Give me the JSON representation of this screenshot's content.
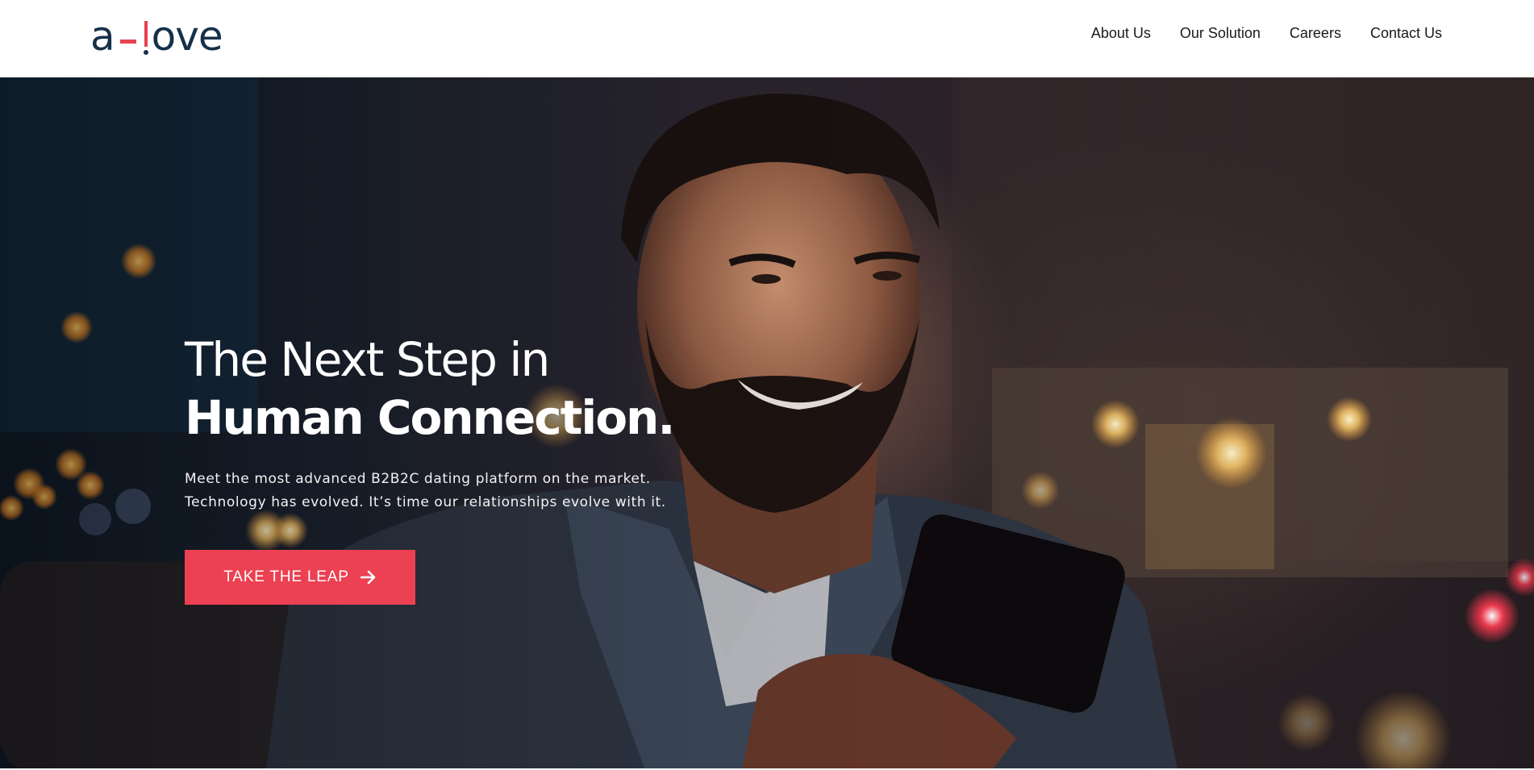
{
  "brand": {
    "logo_left": "a",
    "logo_right": "ove",
    "colors": {
      "navy": "#16304a",
      "accent": "#e8414f"
    }
  },
  "nav": {
    "items": [
      {
        "label": "About Us"
      },
      {
        "label": "Our Solution"
      },
      {
        "label": "Careers"
      },
      {
        "label": "Contact Us"
      }
    ]
  },
  "hero": {
    "headline_line1": "The Next Step in",
    "headline_line2": "Human Connection.",
    "subtext_line1": "Meet the most advanced B2B2C dating platform on the market.",
    "subtext_line2": "Technology has evolved. It’s time our relationships evolve with it.",
    "cta_label": "TAKE THE LEAP",
    "cta_icon": "arrow-right-icon",
    "cta_color": "#ec4152"
  }
}
